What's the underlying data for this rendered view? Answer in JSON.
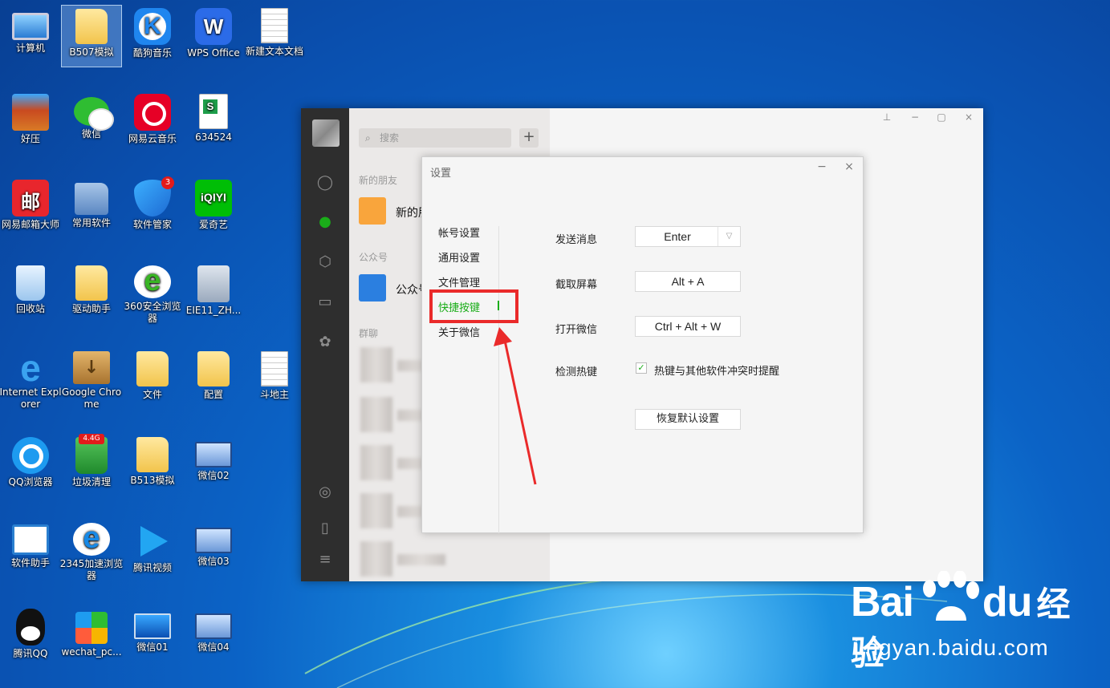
{
  "desktop": {
    "icons": [
      {
        "label": "计算机"
      },
      {
        "label": "B507模拟"
      },
      {
        "label": "酷狗音乐"
      },
      {
        "label": "WPS Office"
      },
      {
        "label": "新建文本文档"
      },
      {
        "label": "好压"
      },
      {
        "label": "微信"
      },
      {
        "label": "网易云音乐"
      },
      {
        "label": "634524"
      },
      {
        "label": "网易邮箱大师"
      },
      {
        "label": "常用软件"
      },
      {
        "label": "软件管家",
        "badge": "3"
      },
      {
        "label": "爱奇艺"
      },
      {
        "label": "回收站"
      },
      {
        "label": "驱动助手"
      },
      {
        "label": "360安全浏览器"
      },
      {
        "label": "EIE11_ZH..."
      },
      {
        "label": "Internet Explorer"
      },
      {
        "label": "Google Chrome"
      },
      {
        "label": "文件"
      },
      {
        "label": "配置"
      },
      {
        "label": "斗地主"
      },
      {
        "label": "QQ浏览器"
      },
      {
        "label": "垃圾清理",
        "badge": "4.4G"
      },
      {
        "label": "B513模拟"
      },
      {
        "label": "微信02"
      },
      {
        "label": "软件助手"
      },
      {
        "label": "2345加速浏览器"
      },
      {
        "label": "腾讯视频"
      },
      {
        "label": "微信03"
      },
      {
        "label": "腾讯QQ"
      },
      {
        "label": "wechat_pc..."
      },
      {
        "label": "微信01"
      },
      {
        "label": "微信04"
      }
    ]
  },
  "wechat": {
    "search_placeholder": "搜索",
    "add_label": "+",
    "sections": {
      "new_friends": "新的朋友",
      "official": "公众号",
      "groups": "群聊"
    },
    "items": {
      "new_friends": "新的朋友",
      "official": "公众号"
    }
  },
  "settings": {
    "title": "设置",
    "minimize": "−",
    "close": "×",
    "nav": [
      {
        "label": "帐号设置"
      },
      {
        "label": "通用设置"
      },
      {
        "label": "文件管理"
      },
      {
        "label": "快捷按键",
        "active": true
      },
      {
        "label": "关于微信"
      }
    ],
    "shortcuts": {
      "send_label": "发送消息",
      "send_value": "Enter",
      "screenshot_label": "截取屏幕",
      "screenshot_value": "Alt + A",
      "open_label": "打开微信",
      "open_value": "Ctrl + Alt + W",
      "hotkey_label": "检测热键",
      "hotkey_check": "热键与其他软件冲突时提醒",
      "hotkey_checked": true,
      "reset_label": "恢复默认设置"
    }
  },
  "watermark": {
    "logo_bai": "Bai",
    "logo_du": "du",
    "logo_cn": "经验",
    "url": "jingyan.baidu.com"
  },
  "colors": {
    "accent": "#1aad19",
    "annotation": "#ea2a2a",
    "sidebar": "#2e2e2e"
  }
}
